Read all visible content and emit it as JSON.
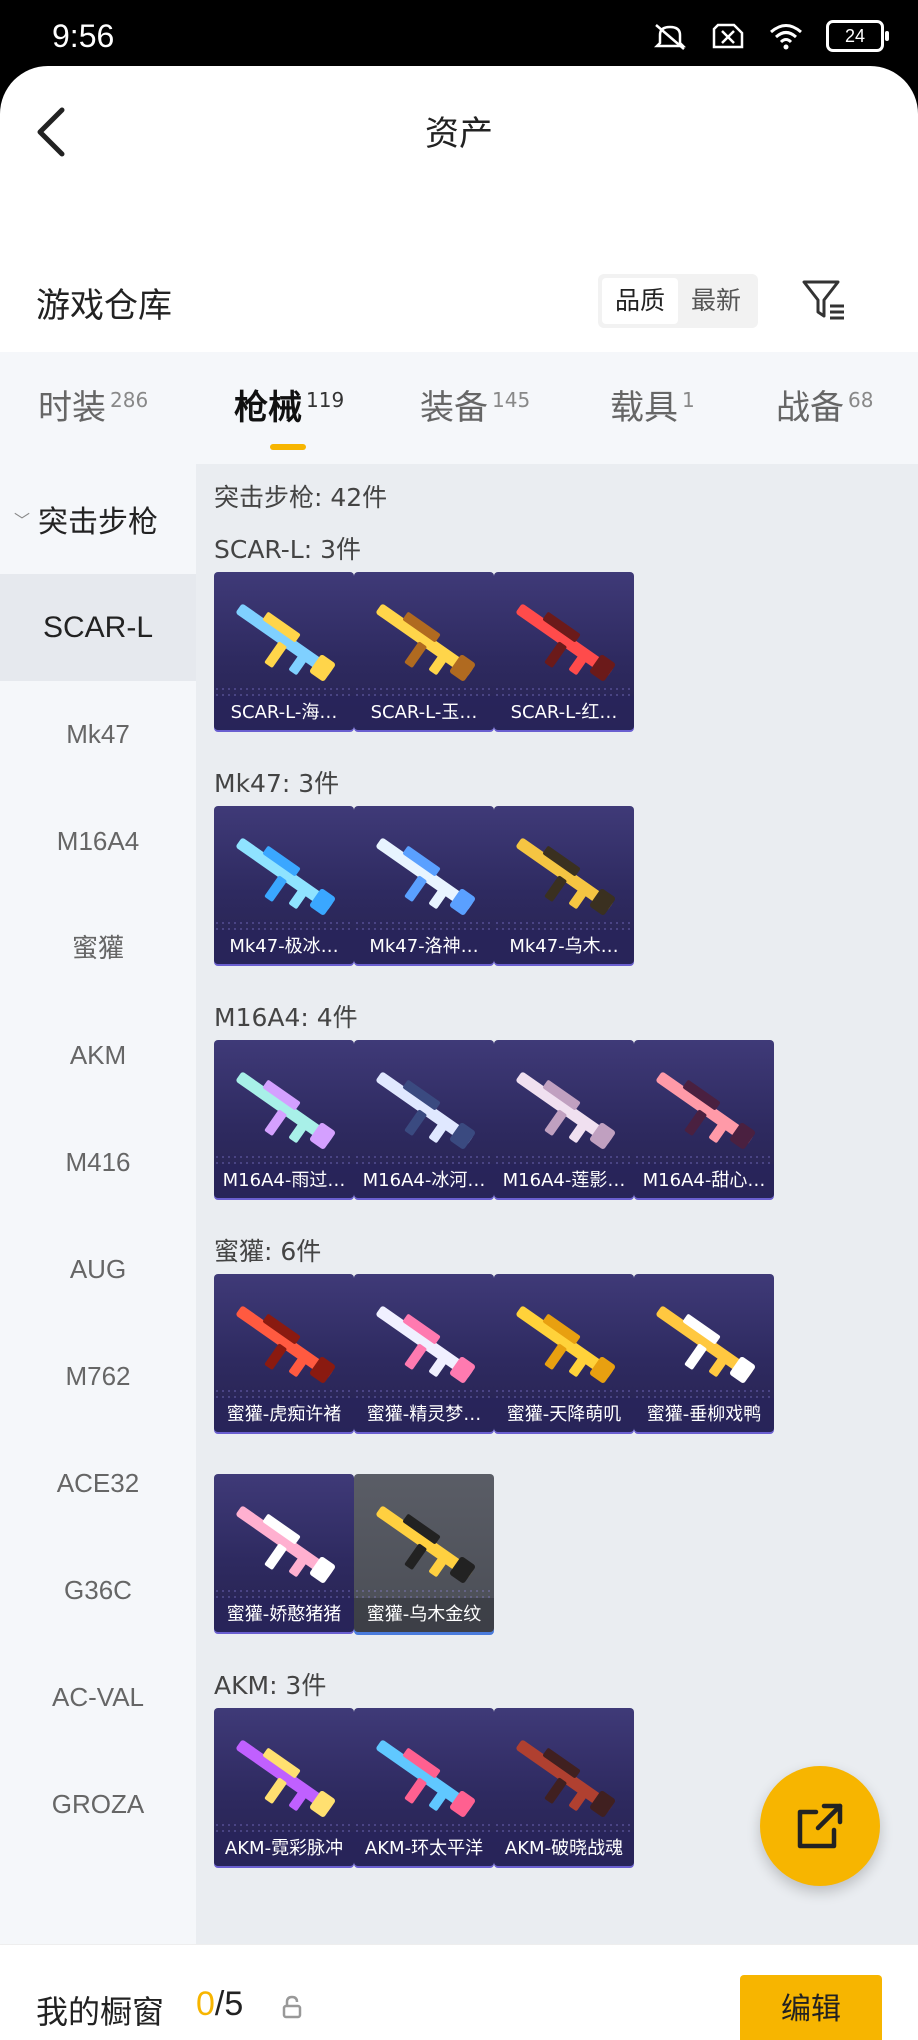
{
  "status_bar": {
    "time": "9:56",
    "battery": "24"
  },
  "header": {
    "title": "资产"
  },
  "warehouse": {
    "title": "游戏仓库",
    "sort": [
      "品质",
      "最新"
    ],
    "sort_active": 0
  },
  "tabs": [
    {
      "label": "时装",
      "count": "286"
    },
    {
      "label": "枪械",
      "count": "119"
    },
    {
      "label": "装备",
      "count": "145"
    },
    {
      "label": "载具",
      "count": "1"
    },
    {
      "label": "战备",
      "count": "68"
    }
  ],
  "active_tab": 1,
  "sidebar": {
    "category": "突击步枪",
    "items": [
      "SCAR-L",
      "Mk47",
      "M16A4",
      "蜜獾",
      "AKM",
      "M416",
      "AUG",
      "M762",
      "ACE32",
      "G36C",
      "AC-VAL",
      "GROZA"
    ],
    "active_index": 0
  },
  "content": {
    "summary": "突击步枪: 42件",
    "sections": [
      {
        "label": "SCAR-L: 3件",
        "items": [
          "SCAR-L-海…",
          "SCAR-L-玉…",
          "SCAR-L-红…"
        ]
      },
      {
        "label": "Mk47: 3件",
        "items": [
          "Mk47-极冰…",
          "Mk47-洛神…",
          "Mk47-乌木…"
        ]
      },
      {
        "label": "M16A4: 4件",
        "items": [
          "M16A4-雨过…",
          "M16A4-冰河…",
          "M16A4-莲影…",
          "M16A4-甜心…"
        ]
      },
      {
        "label": "蜜獾: 6件",
        "items": [
          "蜜獾-虎痴许褚",
          "蜜獾-精灵梦…",
          "蜜獾-天降萌叽",
          "蜜獾-垂柳戏鸭",
          "蜜獾-娇憨猪猪",
          "蜜獾-乌木金纹"
        ]
      },
      {
        "label": "AKM: 3件",
        "items": [
          "AKM-霓彩脉冲",
          "AKM-环太平洋",
          "AKM-破晓战魂"
        ]
      }
    ]
  },
  "showcase": {
    "label": "我的橱窗",
    "current": "0",
    "total": "/5"
  },
  "edit_button": "编辑",
  "colors": {
    "accent": "#f7b500",
    "card_bg": "#2e2a60"
  }
}
